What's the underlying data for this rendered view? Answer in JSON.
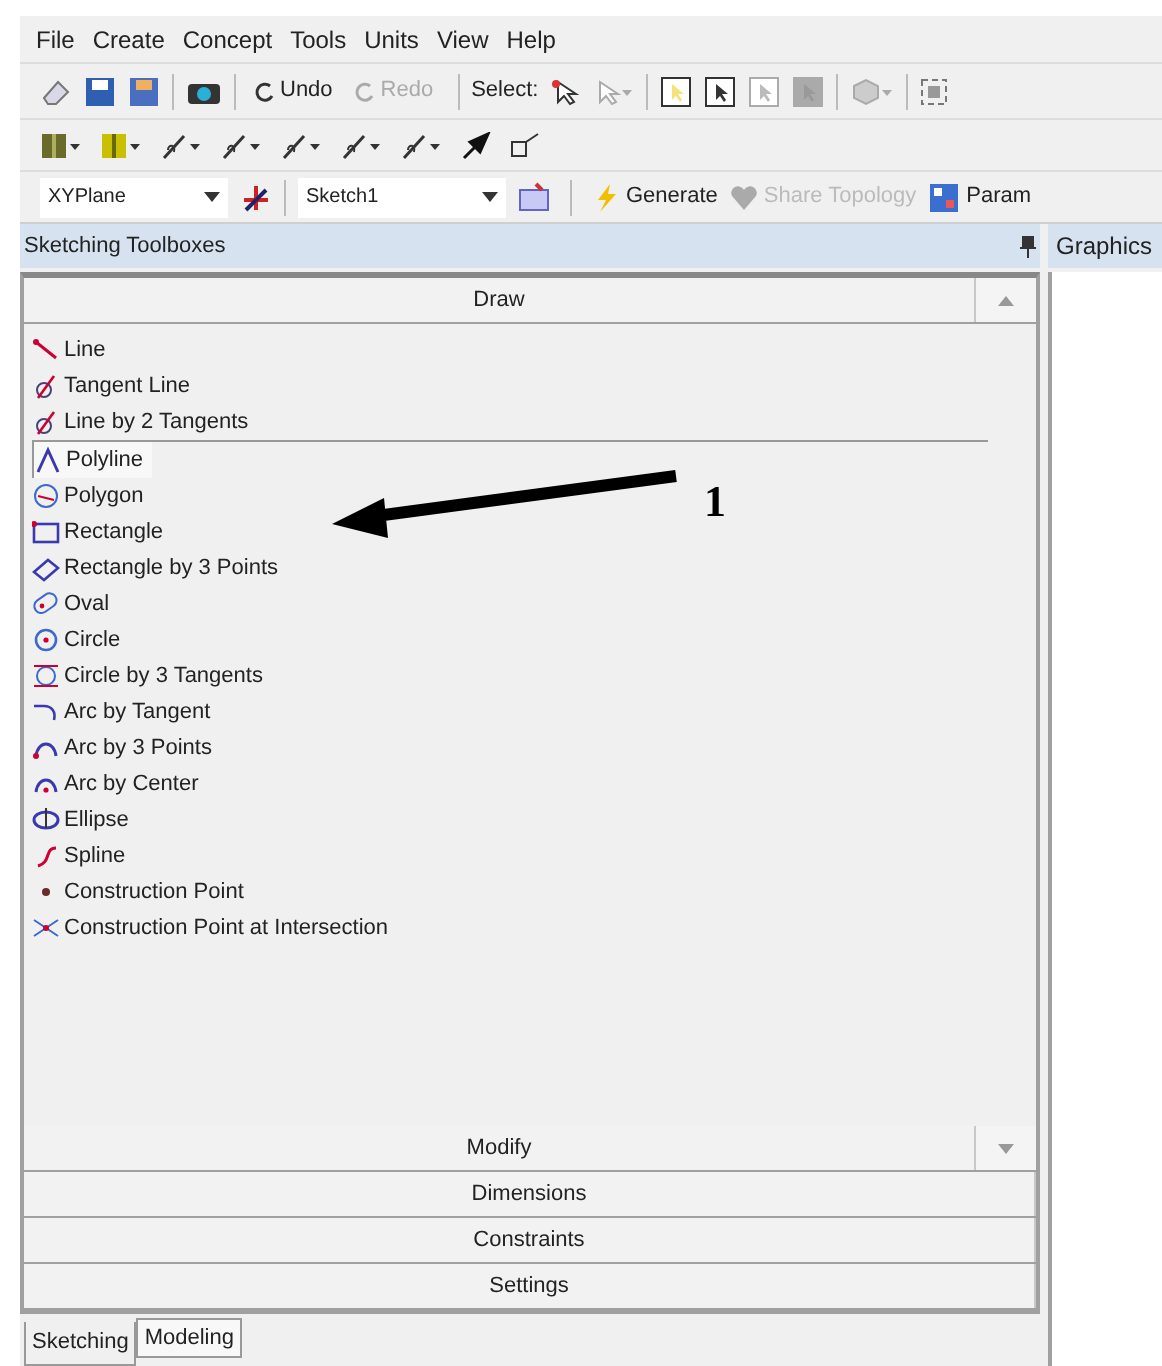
{
  "menu": [
    "File",
    "Create",
    "Concept",
    "Tools",
    "Units",
    "View",
    "Help"
  ],
  "toolbar": {
    "undo": {
      "label": "Undo",
      "disabled": false
    },
    "redo": {
      "label": "Redo",
      "disabled": true
    },
    "select_label": "Select:"
  },
  "sketch_toolbar": {
    "plane": "XYPlane",
    "sketch": "Sketch1",
    "generate": {
      "label": "Generate",
      "disabled": false
    },
    "share_topology": {
      "label": "Share Topology",
      "disabled": true
    },
    "parameters": "Param"
  },
  "panel": {
    "title": "Sketching Toolboxes",
    "groups": [
      {
        "label": "Draw",
        "expanded": true,
        "items": [
          {
            "label": "Line",
            "selected": false
          },
          {
            "label": "Tangent Line",
            "selected": false
          },
          {
            "label": "Line by 2 Tangents",
            "selected": false
          },
          {
            "label": "Polyline",
            "selected": true
          },
          {
            "label": "Polygon",
            "selected": false
          },
          {
            "label": "Rectangle",
            "selected": false
          },
          {
            "label": "Rectangle by 3 Points",
            "selected": false
          },
          {
            "label": "Oval",
            "selected": false
          },
          {
            "label": "Circle",
            "selected": false
          },
          {
            "label": "Circle by 3 Tangents",
            "selected": false
          },
          {
            "label": "Arc by Tangent",
            "selected": false
          },
          {
            "label": "Arc by 3 Points",
            "selected": false
          },
          {
            "label": "Arc by Center",
            "selected": false
          },
          {
            "label": "Ellipse",
            "selected": false
          },
          {
            "label": "Spline",
            "selected": false
          },
          {
            "label": "Construction Point",
            "selected": false
          },
          {
            "label": "Construction Point at Intersection",
            "selected": false
          }
        ]
      },
      {
        "label": "Modify",
        "expanded": false,
        "scroll_down": true
      },
      {
        "label": "Dimensions",
        "expanded": false
      },
      {
        "label": "Constraints",
        "expanded": false
      },
      {
        "label": "Settings",
        "expanded": false
      }
    ],
    "tabs": [
      {
        "label": "Sketching",
        "selected": true
      },
      {
        "label": "Modeling",
        "selected": false
      }
    ]
  },
  "graphics": {
    "title": "Graphics"
  },
  "annotation": {
    "label": "1"
  }
}
